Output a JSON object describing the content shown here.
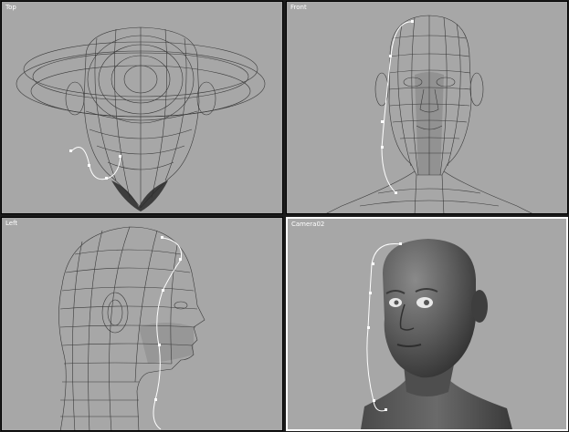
{
  "viewports": {
    "top": {
      "label": "Top"
    },
    "front": {
      "label": "Front"
    },
    "left": {
      "label": "Left"
    },
    "camera": {
      "label": "Camera02"
    }
  },
  "colors": {
    "viewport_bg": "#a7a7a7",
    "wire": "#3a3a3a",
    "spline": "#ffffff",
    "shaded": "#5a5a5a"
  }
}
